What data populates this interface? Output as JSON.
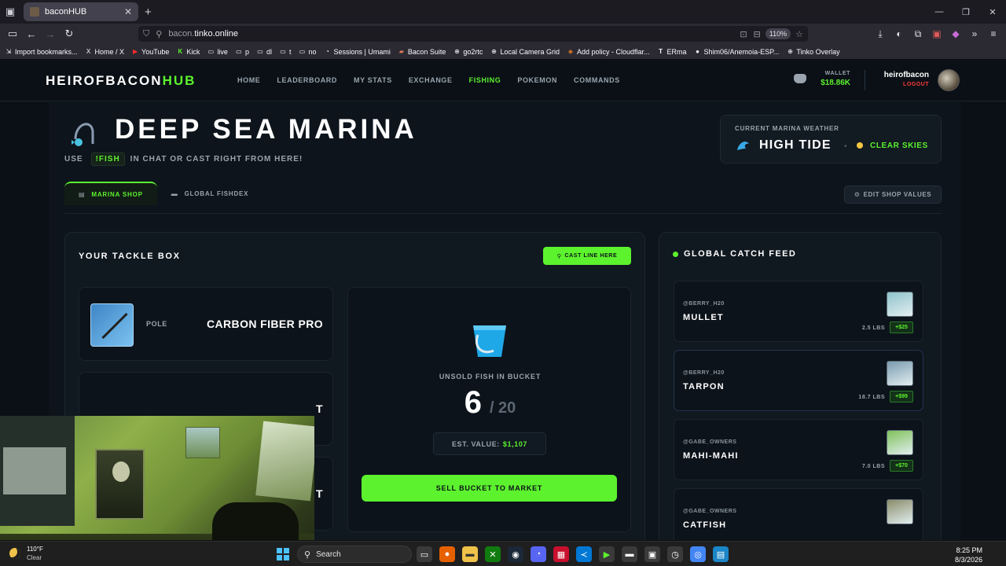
{
  "browser": {
    "tab_title": "baconHUB",
    "url_prefix": "bacon.",
    "url_domain": "tinko.online",
    "zoom": "110%",
    "bookmarks": [
      "Import bookmarks...",
      "Home / X",
      "YouTube",
      "Kick",
      "live",
      "p",
      "dl",
      "t",
      "no",
      "Sessions | Umami",
      "Bacon Suite",
      "go2rtc",
      "Local Camera Grid",
      "Add policy - Cloudflar...",
      "ERma",
      "Shim06/Anemoia-ESP...",
      "Tinko Overlay"
    ]
  },
  "site": {
    "logo_main": "HEIROFBACON",
    "logo_accent": "HUB",
    "nav": [
      "HOME",
      "LEADERBOARD",
      "MY STATS",
      "EXCHANGE",
      "FISHING",
      "POKEMON",
      "COMMANDS"
    ],
    "active_nav": "FISHING",
    "wallet_label": "WALLET",
    "wallet_value": "$18.86K",
    "username": "heirofbacon",
    "logout": "LOGOUT"
  },
  "page": {
    "title": "DEEP SEA MARINA",
    "subtitle_pre": "USE",
    "subtitle_cmd": "!FISH",
    "subtitle_post": "IN CHAT OR CAST RIGHT FROM HERE!"
  },
  "weather": {
    "label": "CURRENT MARINA WEATHER",
    "tide": "HIGH TIDE",
    "sky": "CLEAR SKIES"
  },
  "tabs": [
    {
      "label": "MARINA SHOP",
      "icon": "shop-icon"
    },
    {
      "label": "GLOBAL FISHDEX",
      "icon": "book-icon"
    }
  ],
  "edit_shop": "EDIT SHOP VALUES",
  "tackle": {
    "title": "YOUR TACKLE BOX",
    "cast_button": "CAST LINE HERE",
    "slots": [
      {
        "type": "POLE",
        "name": "CARBON FIBER PRO"
      },
      {
        "type": "",
        "name": "T"
      },
      {
        "type": "",
        "name": "T"
      }
    ]
  },
  "bucket": {
    "label": "UNSOLD FISH IN BUCKET",
    "count": "6",
    "max": "/ 20",
    "est_label": "EST. VALUE:",
    "est_value": "$1,107",
    "sell_button": "SELL BUCKET TO MARKET"
  },
  "feed": {
    "title": "GLOBAL CATCH FEED",
    "items": [
      {
        "user": "@BERRY_H20",
        "fish": "MULLET",
        "weight": "2.5 LBS",
        "price": "+$25",
        "color": "#8fc3cc"
      },
      {
        "user": "@BERRY_H20",
        "fish": "TARPON",
        "weight": "18.7 LBS",
        "price": "+$99",
        "color": "#7a9bb0"
      },
      {
        "user": "@GABE_OWNERS",
        "fish": "MAHI-MAHI",
        "weight": "7.0 LBS",
        "price": "+$70",
        "color": "#7fc25a"
      },
      {
        "user": "@GABE_OWNERS",
        "fish": "CATFISH",
        "weight": "",
        "price": "",
        "color": "#8a8d6a"
      }
    ]
  },
  "taskbar": {
    "temp": "110°F",
    "condition": "Clear",
    "search": "Search",
    "time": "8:25 PM",
    "date": "8/3/2026"
  },
  "colors": {
    "accent": "#5cf22e",
    "background": "#0d141b",
    "logout": "#ff3b3b"
  }
}
